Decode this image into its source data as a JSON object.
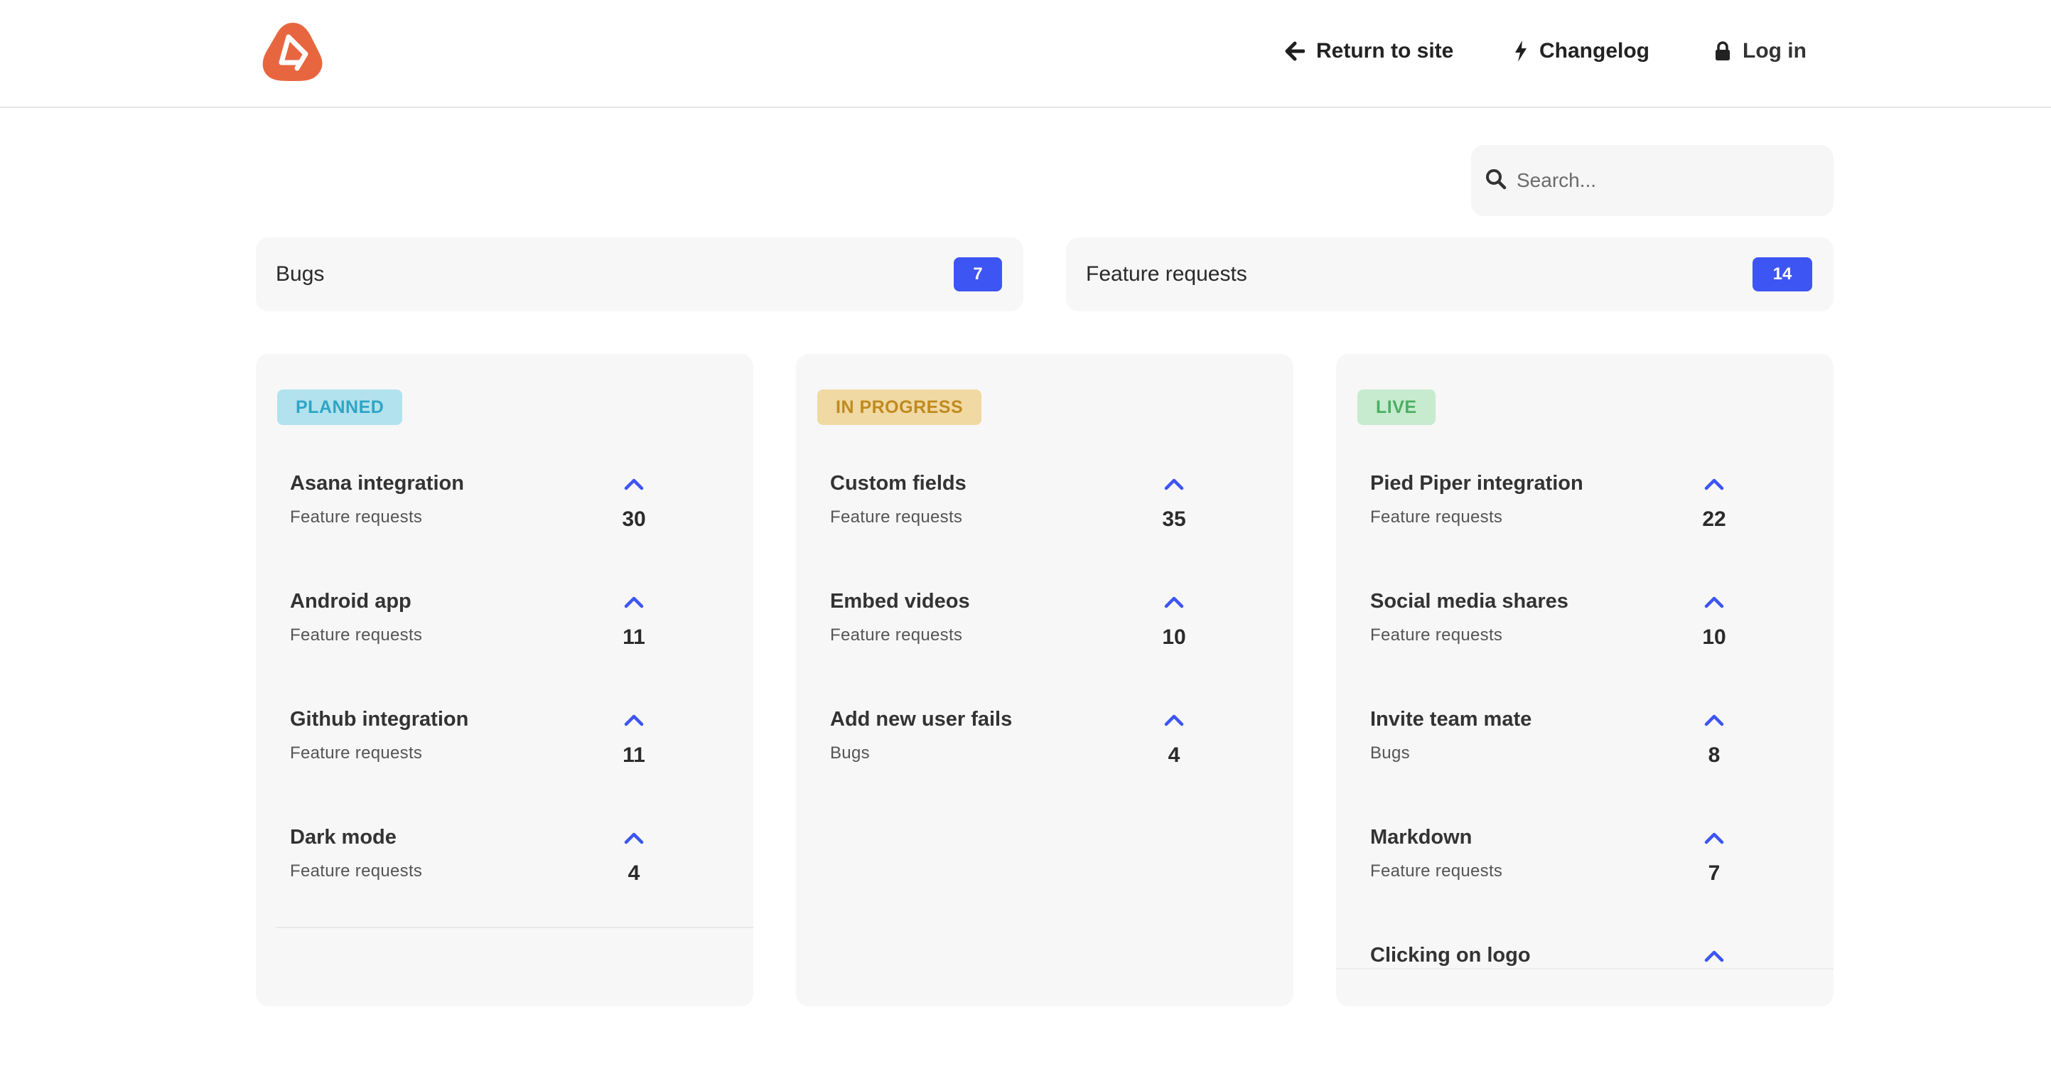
{
  "header": {
    "logo_name": "app-logo",
    "nav": [
      {
        "label": "Return to site",
        "icon": "arrow-left-icon"
      },
      {
        "label": "Changelog",
        "icon": "lightning-icon"
      },
      {
        "label": "Log in",
        "icon": "lock-icon"
      }
    ]
  },
  "search": {
    "placeholder": "Search..."
  },
  "categories": [
    {
      "label": "Bugs",
      "count": "7"
    },
    {
      "label": "Feature requests",
      "count": "14"
    }
  ],
  "accent_color": "#3d55f3",
  "columns": [
    {
      "status": "PLANNED",
      "items": [
        {
          "title": "Asana integration",
          "category": "Feature requests",
          "votes": "30"
        },
        {
          "title": "Android app",
          "category": "Feature requests",
          "votes": "11"
        },
        {
          "title": "Github integration",
          "category": "Feature requests",
          "votes": "11"
        },
        {
          "title": "Dark mode",
          "category": "Feature requests",
          "votes": "4"
        }
      ]
    },
    {
      "status": "IN PROGRESS",
      "items": [
        {
          "title": "Custom fields",
          "category": "Feature requests",
          "votes": "35"
        },
        {
          "title": "Embed videos",
          "category": "Feature requests",
          "votes": "10"
        },
        {
          "title": "Add new user fails",
          "category": "Bugs",
          "votes": "4"
        }
      ]
    },
    {
      "status": "LIVE",
      "items": [
        {
          "title": "Pied Piper integration",
          "category": "Feature requests",
          "votes": "22"
        },
        {
          "title": "Social media shares",
          "category": "Feature requests",
          "votes": "10"
        },
        {
          "title": "Invite team mate",
          "category": "Bugs",
          "votes": "8"
        },
        {
          "title": "Markdown",
          "category": "Feature requests",
          "votes": "7"
        },
        {
          "title": "Clicking on logo",
          "category": "",
          "votes": ""
        }
      ]
    }
  ]
}
